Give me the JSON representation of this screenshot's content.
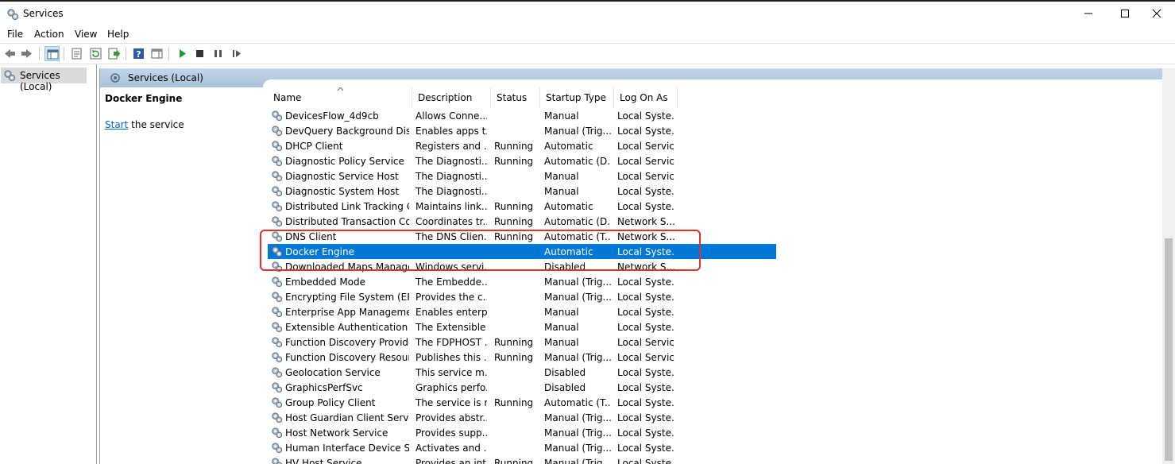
{
  "window": {
    "title": "Services"
  },
  "menu": [
    "File",
    "Action",
    "View",
    "Help"
  ],
  "toolbar": {
    "icons": [
      "back-icon",
      "forward-icon",
      "show-hide-console-tree-icon",
      "properties-icon",
      "refresh-icon",
      "export-list-icon",
      "help-icon",
      "show-hide-action-pane-icon",
      "start-service-icon",
      "stop-service-icon",
      "pause-service-icon",
      "resume-service-icon"
    ]
  },
  "tree": {
    "root_label": "Services (Local)"
  },
  "pane": {
    "header_label": "Services (Local)",
    "selected_service": "Docker Engine",
    "start_link": "Start",
    "start_suffix": " the service"
  },
  "columns": {
    "name": "Name",
    "description": "Description",
    "status": "Status",
    "startup": "Startup Type",
    "logon": "Log On As"
  },
  "services": [
    {
      "name": "DevicesFlow_4d9cb",
      "desc": "Allows Conne...",
      "status": "",
      "startup": "Manual",
      "logon": "Local Syste..."
    },
    {
      "name": "DevQuery Background Disc...",
      "desc": "Enables apps t...",
      "status": "",
      "startup": "Manual (Trig...",
      "logon": "Local Syste..."
    },
    {
      "name": "DHCP Client",
      "desc": "Registers and ...",
      "status": "Running",
      "startup": "Automatic",
      "logon": "Local Service"
    },
    {
      "name": "Diagnostic Policy Service",
      "desc": "The Diagnosti...",
      "status": "Running",
      "startup": "Automatic (D...",
      "logon": "Local Service"
    },
    {
      "name": "Diagnostic Service Host",
      "desc": "The Diagnosti...",
      "status": "",
      "startup": "Manual",
      "logon": "Local Service"
    },
    {
      "name": "Diagnostic System Host",
      "desc": "The Diagnosti...",
      "status": "",
      "startup": "Manual",
      "logon": "Local Syste..."
    },
    {
      "name": "Distributed Link Tracking Cl...",
      "desc": "Maintains link...",
      "status": "Running",
      "startup": "Automatic",
      "logon": "Local Syste..."
    },
    {
      "name": "Distributed Transaction Coo...",
      "desc": "Coordinates tr...",
      "status": "Running",
      "startup": "Automatic (D...",
      "logon": "Network S..."
    },
    {
      "name": "DNS Client",
      "desc": "The DNS Clien...",
      "status": "Running",
      "startup": "Automatic (T...",
      "logon": "Network S..."
    },
    {
      "name": "Docker Engine",
      "desc": "",
      "status": "",
      "startup": "Automatic",
      "logon": "Local Syste...",
      "selected": true
    },
    {
      "name": "Downloaded Maps Manager",
      "desc": "Windows servi...",
      "status": "",
      "startup": "Disabled",
      "logon": "Network S..."
    },
    {
      "name": "Embedded Mode",
      "desc": "The Embedde...",
      "status": "",
      "startup": "Manual (Trig...",
      "logon": "Local Syste..."
    },
    {
      "name": "Encrypting File System (EFS)",
      "desc": "Provides the c...",
      "status": "",
      "startup": "Manual (Trig...",
      "logon": "Local Syste..."
    },
    {
      "name": "Enterprise App Managemen...",
      "desc": "Enables enterp...",
      "status": "",
      "startup": "Manual",
      "logon": "Local Syste..."
    },
    {
      "name": "Extensible Authentication P...",
      "desc": "The Extensible ...",
      "status": "",
      "startup": "Manual",
      "logon": "Local Syste..."
    },
    {
      "name": "Function Discovery Provide...",
      "desc": "The FDPHOST ...",
      "status": "Running",
      "startup": "Manual",
      "logon": "Local Service"
    },
    {
      "name": "Function Discovery Resourc...",
      "desc": "Publishes this ...",
      "status": "Running",
      "startup": "Manual (Trig...",
      "logon": "Local Service"
    },
    {
      "name": "Geolocation Service",
      "desc": "This service m...",
      "status": "",
      "startup": "Disabled",
      "logon": "Local Syste..."
    },
    {
      "name": "GraphicsPerfSvc",
      "desc": "Graphics perfo...",
      "status": "",
      "startup": "Disabled",
      "logon": "Local Syste..."
    },
    {
      "name": "Group Policy Client",
      "desc": "The service is r...",
      "status": "Running",
      "startup": "Automatic (T...",
      "logon": "Local Syste..."
    },
    {
      "name": "Host Guardian Client Service",
      "desc": "Provides abstr...",
      "status": "",
      "startup": "Manual (Trig...",
      "logon": "Local Syste..."
    },
    {
      "name": "Host Network Service",
      "desc": "Provides supp...",
      "status": "",
      "startup": "Manual (Trig...",
      "logon": "Local Syste..."
    },
    {
      "name": "Human Interface Device Ser...",
      "desc": "Activates and ...",
      "status": "",
      "startup": "Manual (Trig...",
      "logon": "Local Syste..."
    },
    {
      "name": "HV Host Service",
      "desc": "Provides an int...",
      "status": "Running",
      "startup": "Manual (Trig...",
      "logon": "Local Syste..."
    }
  ],
  "colors": {
    "selection": "#0078d7",
    "highlight_border": "#e2312a",
    "pane_header": "#b6cbe0",
    "link": "#0066cc"
  }
}
